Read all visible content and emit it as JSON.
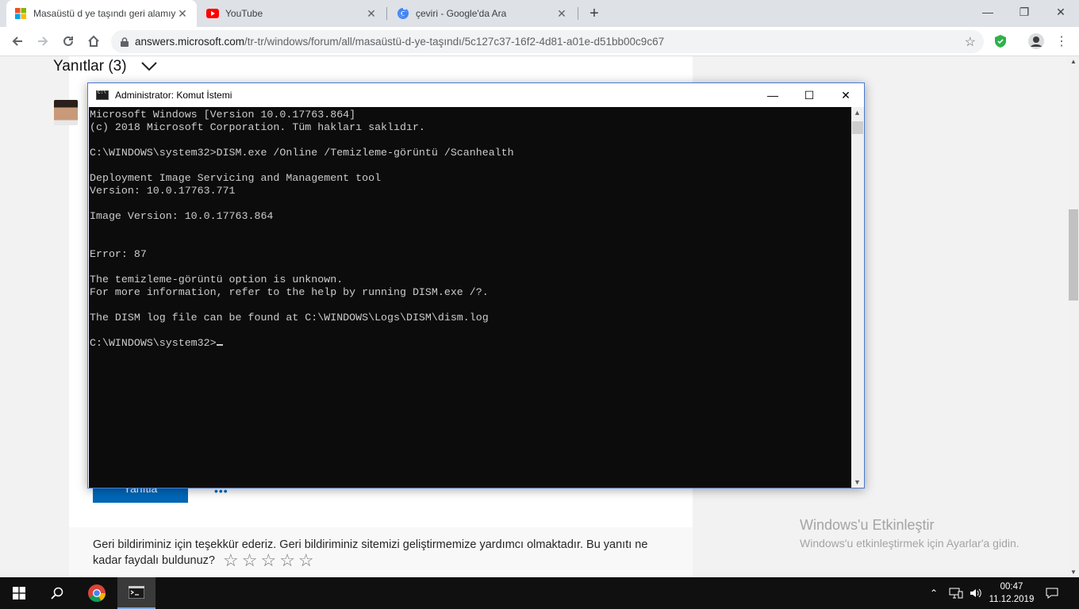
{
  "browser": {
    "tabs": [
      {
        "title": "Masaüstü d ye taşındı geri alamıyor",
        "favicon": "microsoft-icon",
        "active": true
      },
      {
        "title": "YouTube",
        "favicon": "youtube-icon",
        "active": false
      },
      {
        "title": "çeviri - Google'da Ara",
        "favicon": "google-icon",
        "active": false
      }
    ],
    "url_host": "answers.microsoft.com",
    "url_path": "/tr-tr/windows/forum/all/masaüstü-d-ye-taşındı/5c127c37-16f2-4d81-a01e-d51bb00c9c67"
  },
  "page": {
    "answers_heading": "Yanıtlar (3)",
    "reply_button": "Yanıtla",
    "more_dots": "•••",
    "feedback_text": "Geri bildiriminiz için teşekkür ederiz. Geri bildiriminiz sitemizi geliştirmemize yardımcı olmaktadır. Bu yanıtı ne kadar faydalı buldunuz?",
    "star_glyph": "☆",
    "rating_stars": 5
  },
  "watermark": {
    "title": "Windows'u Etkinleştir",
    "subtitle": "Windows'u etkinleştirmek için Ayarlar'a gidin."
  },
  "console": {
    "title": "Administrator: Komut İstemi",
    "lines": [
      "Microsoft Windows [Version 10.0.17763.864]",
      "(c) 2018 Microsoft Corporation. Tüm hakları saklıdır.",
      "",
      "C:\\WINDOWS\\system32>DISM.exe /Online /Temizleme-görüntü /Scanhealth",
      "",
      "Deployment Image Servicing and Management tool",
      "Version: 10.0.17763.771",
      "",
      "Image Version: 10.0.17763.864",
      "",
      "",
      "Error: 87",
      "",
      "The temizleme-görüntü option is unknown.",
      "For more information, refer to the help by running DISM.exe /?.",
      "",
      "The DISM log file can be found at C:\\WINDOWS\\Logs\\DISM\\dism.log",
      ""
    ],
    "prompt": "C:\\WINDOWS\\system32>"
  },
  "taskbar": {
    "time": "00:47",
    "date": "11.12.2019"
  }
}
